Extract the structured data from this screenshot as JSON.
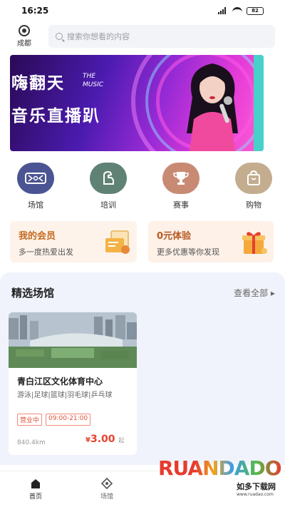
{
  "status_bar": {
    "time": "16:25",
    "battery": "82"
  },
  "header": {
    "location": "成都",
    "search_placeholder": "搜索你想看的内容"
  },
  "banner": {
    "title_line1": "嗨翻天",
    "title_en": "THE MUSIC",
    "title_line2": "音乐直播趴",
    "colors": {
      "start": "#2a0a55",
      "end": "#ff5fd3"
    }
  },
  "categories": [
    {
      "label": "场馆",
      "icon": "stadium-icon",
      "color": "#4b5593"
    },
    {
      "label": "培训",
      "icon": "muscle-icon",
      "color": "#5f8275"
    },
    {
      "label": "赛事",
      "icon": "trophy-icon",
      "color": "#c98a74"
    },
    {
      "label": "购物",
      "icon": "shopping-bag-icon",
      "color": "#c4ad8f"
    }
  ],
  "promos": [
    {
      "title": "我的会员",
      "subtitle": "多一度热爱出发",
      "icon": "member-card-icon",
      "color": "#c4691f"
    },
    {
      "title": "0元体验",
      "subtitle": "更多优惠等你发现",
      "icon": "gift-icon",
      "color": "#b75a21"
    }
  ],
  "venues_section": {
    "title": "精选场馆",
    "more": "查看全部",
    "venue": {
      "name": "青白江区文化体育中心",
      "tags": "游泳|足球|篮球|羽毛球|乒乓球",
      "status": "营业中",
      "hours": "09:00-21:00",
      "distance": "840.4km",
      "price_symbol": "¥",
      "price": "3.00",
      "price_unit": "起"
    }
  },
  "tabbar": {
    "tabs": [
      {
        "label": "首页",
        "icon": "home-icon",
        "active": true
      },
      {
        "label": "场馆",
        "icon": "venue-tab-icon",
        "active": false
      }
    ]
  },
  "watermark": {
    "text": "RUANDADO",
    "subtitle": "如多下载网",
    "url": "www.ruadao.com"
  },
  "colors": {
    "accent_red": "#e6432f",
    "section_bg": "#f0f3fb"
  }
}
